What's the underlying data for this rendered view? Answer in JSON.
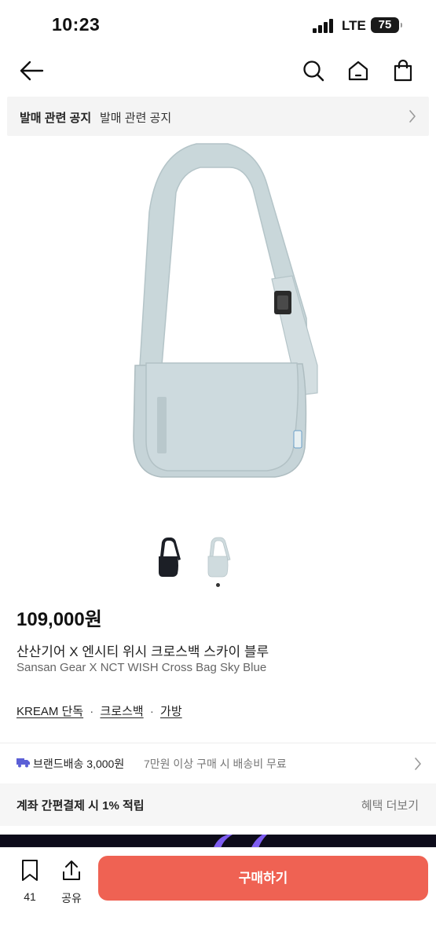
{
  "status_bar": {
    "time": "10:23",
    "network": "LTE",
    "battery": "75"
  },
  "top_nav": {
    "icons": [
      "back-arrow-icon",
      "search-icon",
      "home-icon",
      "shopping-bag-icon"
    ]
  },
  "notice": {
    "title": "발매 관련 공지",
    "subtitle": "발매 관련 공지"
  },
  "product": {
    "price": "109,000원",
    "name_ko": "산산기어 X 엔시티 위시 크로스백 스카이 블루",
    "name_en": "Sansan Gear X NCT WISH Cross Bag Sky Blue",
    "thumbnails": [
      {
        "color": "#1c1f26",
        "label": "black"
      },
      {
        "color": "#cfdbde",
        "label": "sky-blue"
      }
    ],
    "selected_thumbnail": 2,
    "main_color": "#cad7da"
  },
  "tags": {
    "items": [
      "KREAM 단독",
      "크로스백",
      "가방"
    ],
    "separator": "·"
  },
  "shipping": {
    "label": "브랜드배송 3,000원",
    "note": "7만원 이상 구매 시 배송비 무료"
  },
  "benefit": {
    "text": "계좌 간편결제 시 1% 적립",
    "more": "혜택 더보기"
  },
  "bottom_bar": {
    "bookmark_count": "41",
    "share_label": "공유",
    "buy_label": "구매하기",
    "buy_color": "#ef6253"
  }
}
